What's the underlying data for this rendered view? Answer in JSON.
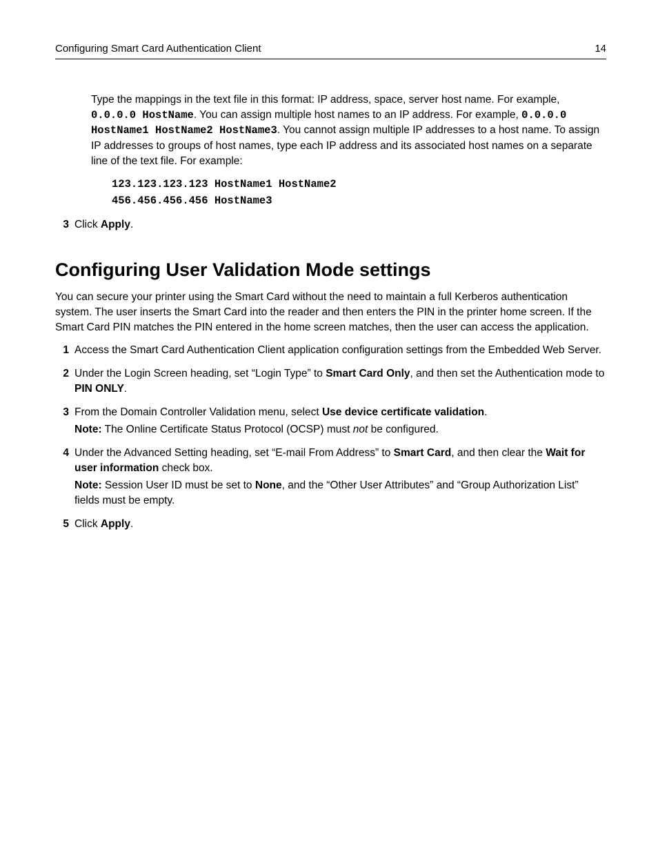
{
  "header": {
    "title": "Configuring Smart Card Authentication Client",
    "page_number": "14"
  },
  "intro_block": {
    "p1_pre": "Type the mappings in the text file in this format: IP address, space, server host name. For example, ",
    "p1_code1": "0.0.0.0 HostName",
    "p1_mid1": ". You can assign multiple host names to an IP address. For example, ",
    "p1_code2": "0.0.0.0 HostName1 HostName2 HostName3",
    "p1_mid2": ". You cannot assign multiple IP addresses to a host name. To assign IP addresses to groups of host names, type each IP address and its associated host names on a separate line of the text file. For example:",
    "code_line1": "123.123.123.123 HostName1 HostName2",
    "code_line2": "456.456.456.456 HostName3"
  },
  "top_list": {
    "item3": {
      "marker": "3",
      "pre": "Click ",
      "bold": "Apply",
      "post": "."
    }
  },
  "section": {
    "title": "Configuring User Validation Mode settings",
    "intro": "You can secure your printer using the Smart Card without the need to maintain a full Kerberos authentication system. The user inserts the Smart Card into the reader and then enters the PIN in the printer home screen. If the Smart Card PIN matches the PIN entered in the home screen matches, then the user can access the application."
  },
  "steps": {
    "s1": {
      "marker": "1",
      "text": "Access the Smart Card Authentication Client application configuration settings from the Embedded Web Server."
    },
    "s2": {
      "marker": "2",
      "pre": "Under the Login Screen heading, set “Login Type” to ",
      "b1": "Smart Card Only",
      "mid": ", and then set the Authentication mode to ",
      "b2": "PIN ONLY",
      "post": "."
    },
    "s3": {
      "marker": "3",
      "pre": "From the Domain Controller Validation menu, select ",
      "b1": "Use device certificate validation",
      "post": ".",
      "note_label": "Note:",
      "note_pre": " The Online Certificate Status Protocol (OCSP) must ",
      "note_italic": "not",
      "note_post": " be configured."
    },
    "s4": {
      "marker": "4",
      "pre": "Under the Advanced Setting heading, set “E-mail From Address” to ",
      "b1": "Smart Card",
      "mid": ", and then clear the ",
      "b2": "Wait for user information",
      "post": " check box.",
      "note_label": "Note:",
      "note_pre": " Session User ID must be set to ",
      "note_b": "None",
      "note_post": ", and the “Other User Attributes” and “Group Authorization List” fields must be empty."
    },
    "s5": {
      "marker": "5",
      "pre": "Click ",
      "b1": "Apply",
      "post": "."
    }
  }
}
